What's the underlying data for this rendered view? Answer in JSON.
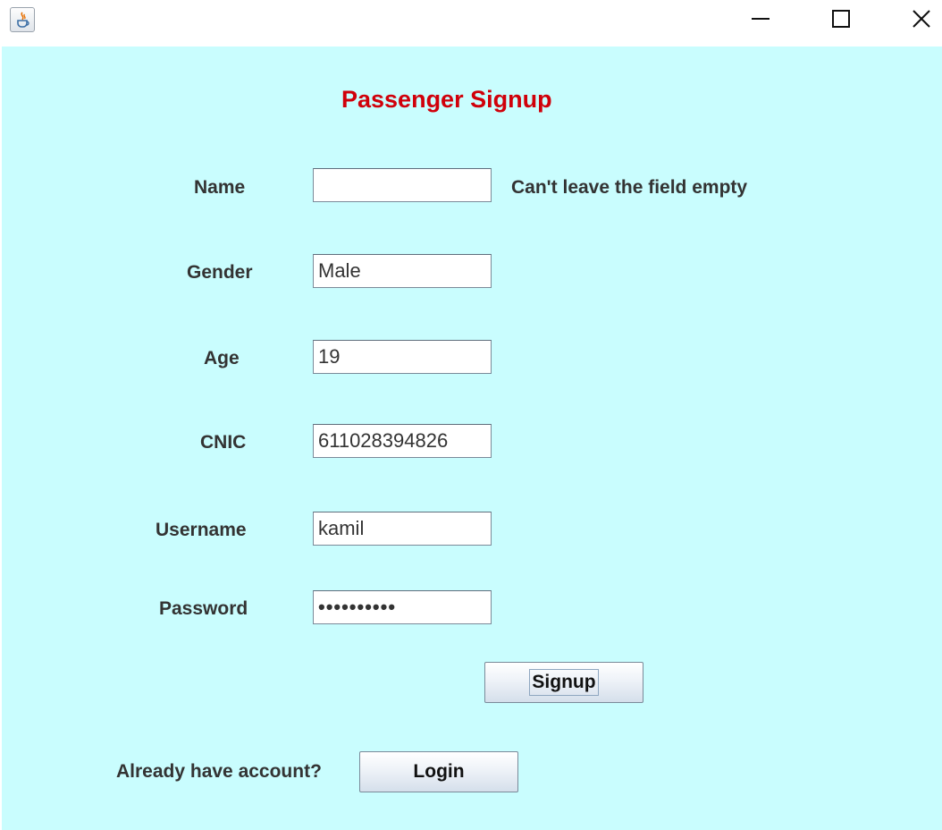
{
  "window": {
    "title": "",
    "icon": "java-cup-icon",
    "controls": {
      "minimize": "minimize-icon",
      "maximize": "maximize-icon",
      "close": "close-icon"
    }
  },
  "form": {
    "title": "Passenger Signup",
    "fields": {
      "name": {
        "label": "Name",
        "value": "",
        "error": "Can't leave the field empty"
      },
      "gender": {
        "label": "Gender",
        "value": "Male"
      },
      "age": {
        "label": "Age",
        "value": "19"
      },
      "cnic": {
        "label": "CNIC",
        "value": "611028394826"
      },
      "username": {
        "label": "Username",
        "value": "kamil"
      },
      "password": {
        "label": "Password",
        "value": "••••••••••"
      }
    },
    "signup_button": "Signup",
    "login_prompt": "Already have account?",
    "login_button": "Login"
  },
  "colors": {
    "background": "#c9fdfe",
    "title": "#d0000a",
    "label": "#333333"
  }
}
